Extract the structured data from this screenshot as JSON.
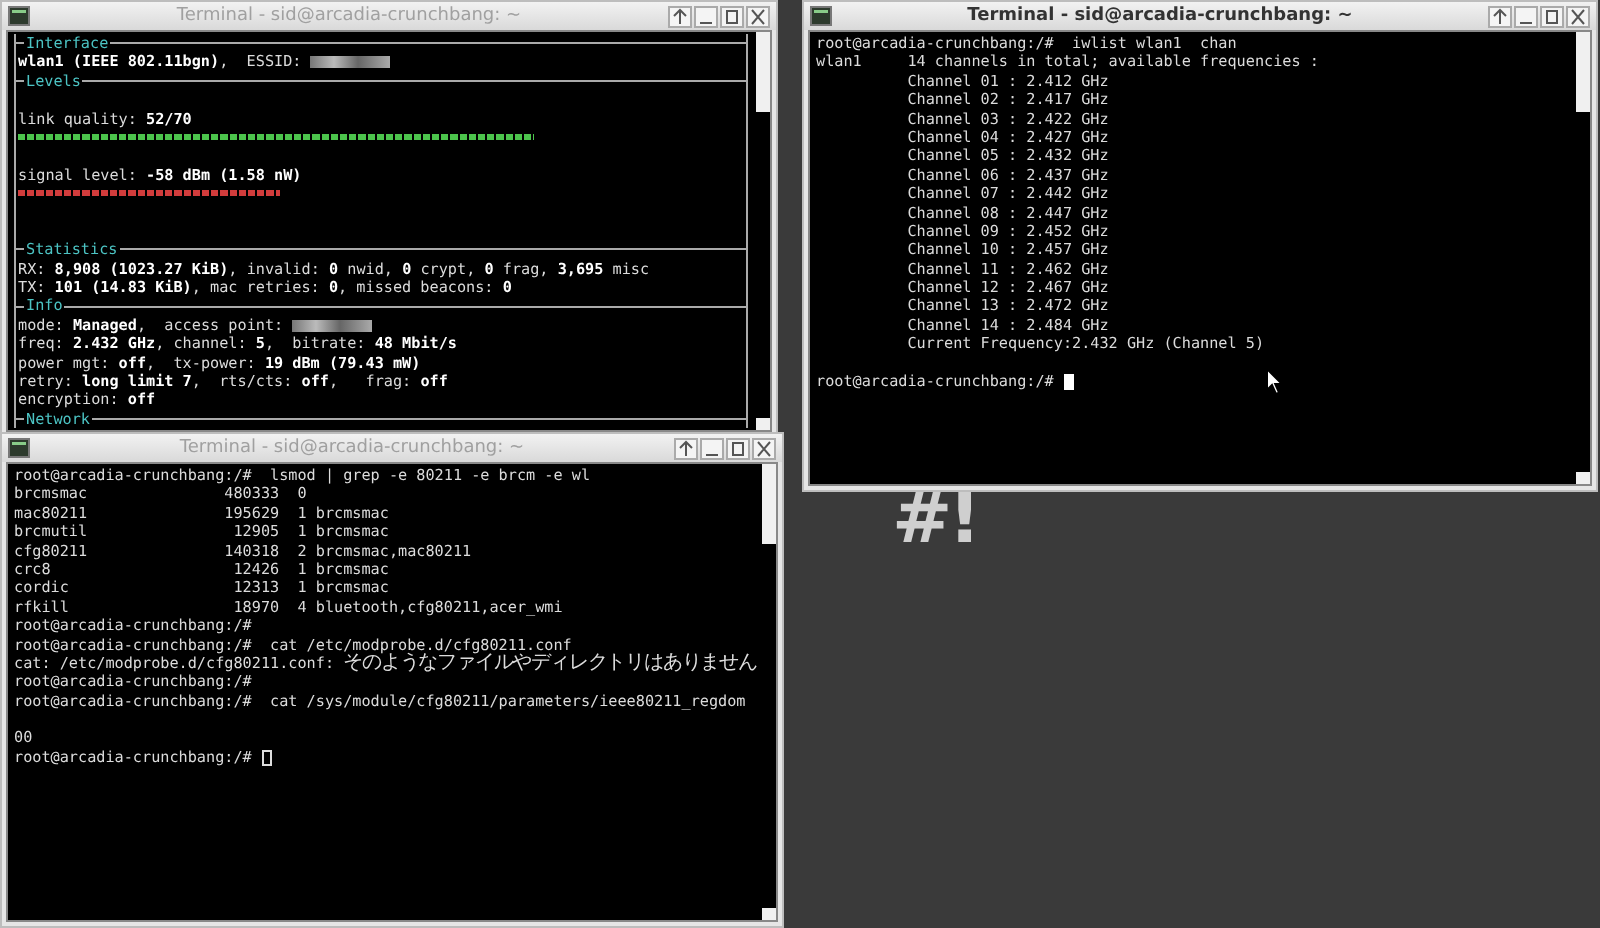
{
  "desktop": {
    "logo": "#!"
  },
  "windows": [
    {
      "kind": "wavemon",
      "title": "Terminal - sid@arcadia-crunchbang: ~",
      "active": false,
      "sections": [
        {
          "title": "Interface",
          "lines": [
            {
              "kind": "text",
              "text": "**wlan1 (IEEE 802.11bgn)**,  ESSID: ",
              "redacted": true
            }
          ]
        },
        {
          "title": "Levels",
          "lines": [
            {
              "kind": "blank"
            },
            {
              "kind": "text",
              "text": "link quality: **52/70**"
            },
            {
              "kind": "meter",
              "level": 0.71,
              "color": "#4cc44c"
            },
            {
              "kind": "blank"
            },
            {
              "kind": "text",
              "text": "signal level: **-58 dBm (1.58 nW)**"
            },
            {
              "kind": "meter",
              "level": 0.36,
              "color": "#d23c3c"
            },
            {
              "kind": "blank"
            },
            {
              "kind": "blank"
            }
          ]
        },
        {
          "title": "Statistics",
          "lines": [
            {
              "kind": "text",
              "text": "RX: **8,908 (1023.27 KiB)**, invalid: **0** nwid, **0** crypt, **0** frag, **3,695** misc"
            },
            {
              "kind": "text",
              "text": "TX: **101 (14.83 KiB)**, mac retries: **0**, missed beacons: **0**"
            }
          ]
        },
        {
          "title": "Info",
          "lines": [
            {
              "kind": "text",
              "text": "mode: **Managed**,  access point: ",
              "redacted": true
            },
            {
              "kind": "text",
              "text": "freq: **2.432 GHz**, channel: **5**,  bitrate: **48 Mbit/s**"
            },
            {
              "kind": "text",
              "text": "power mgt: **off**,  tx-power: **19 dBm (79.43 mW)**"
            },
            {
              "kind": "text",
              "text": "retry: **long limit 7**,  rts/cts: **off**,   frag: **off**"
            },
            {
              "kind": "text",
              "text": "encryption: **off**"
            }
          ]
        },
        {
          "title": "Network"
        }
      ]
    },
    {
      "kind": "shell",
      "title": "Terminal - sid@arcadia-crunchbang: ~",
      "active": false,
      "lines": [
        {
          "kind": "text",
          "text": "root@arcadia-crunchbang:/#  lsmod | grep -e 80211 -e brcm -e wl"
        },
        {
          "kind": "text",
          "text": "brcmsmac               480333  0"
        },
        {
          "kind": "text",
          "text": "mac80211               195629  1 brcmsmac"
        },
        {
          "kind": "text",
          "text": "brcmutil                12905  1 brcmsmac"
        },
        {
          "kind": "text",
          "text": "cfg80211               140318  2 brcmsmac,mac80211"
        },
        {
          "kind": "text",
          "text": "crc8                    12426  1 brcmsmac"
        },
        {
          "kind": "text",
          "text": "cordic                  12313  1 brcmsmac"
        },
        {
          "kind": "text",
          "text": "rfkill                  18970  4 bluetooth,cfg80211,acer_wmi"
        },
        {
          "kind": "text",
          "text": "root@arcadia-crunchbang:/#"
        },
        {
          "kind": "text",
          "text": "root@arcadia-crunchbang:/#  cat /etc/modprobe.d/cfg80211.conf"
        },
        {
          "kind": "error",
          "text": "cat: /etc/modprobe.d/cfg80211.conf: ",
          "wide_text": "そのようなファイルやディレクトリはありません"
        },
        {
          "kind": "text",
          "text": "root@arcadia-crunchbang:/#"
        },
        {
          "kind": "text",
          "text": "root@arcadia-crunchbang:/#  cat /sys/module/cfg80211/parameters/ieee80211_regdom"
        },
        {
          "kind": "blank"
        },
        {
          "kind": "text",
          "text": "00"
        },
        {
          "kind": "prompt",
          "text": "root@arcadia-crunchbang:/#"
        }
      ]
    },
    {
      "kind": "shell",
      "title": "Terminal - sid@arcadia-crunchbang: ~",
      "active": true,
      "lines": [
        {
          "kind": "text",
          "text": "root@arcadia-crunchbang:/#  iwlist wlan1  chan"
        },
        {
          "kind": "text",
          "text": "wlan1     14 channels in total; available frequencies :"
        },
        {
          "kind": "text",
          "text": "          Channel 01 : 2.412 GHz"
        },
        {
          "kind": "text",
          "text": "          Channel 02 : 2.417 GHz"
        },
        {
          "kind": "text",
          "text": "          Channel 03 : 2.422 GHz"
        },
        {
          "kind": "text",
          "text": "          Channel 04 : 2.427 GHz"
        },
        {
          "kind": "text",
          "text": "          Channel 05 : 2.432 GHz"
        },
        {
          "kind": "text",
          "text": "          Channel 06 : 2.437 GHz"
        },
        {
          "kind": "text",
          "text": "          Channel 07 : 2.442 GHz"
        },
        {
          "kind": "text",
          "text": "          Channel 08 : 2.447 GHz"
        },
        {
          "kind": "text",
          "text": "          Channel 09 : 2.452 GHz"
        },
        {
          "kind": "text",
          "text": "          Channel 10 : 2.457 GHz"
        },
        {
          "kind": "text",
          "text": "          Channel 11 : 2.462 GHz"
        },
        {
          "kind": "text",
          "text": "          Channel 12 : 2.467 GHz"
        },
        {
          "kind": "text",
          "text": "          Channel 13 : 2.472 GHz"
        },
        {
          "kind": "text",
          "text": "          Channel 14 : 2.484 GHz"
        },
        {
          "kind": "text",
          "text": "          Current Frequency:2.432 GHz (Channel 5)"
        },
        {
          "kind": "blank"
        },
        {
          "kind": "prompt",
          "text": "root@arcadia-crunchbang:/#"
        }
      ]
    }
  ]
}
